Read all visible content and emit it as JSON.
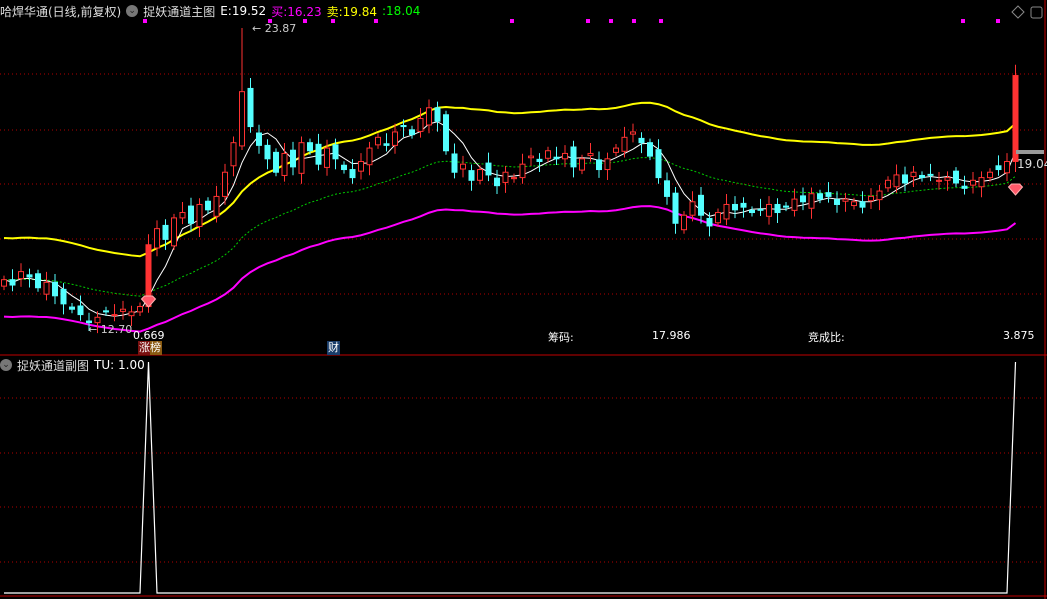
{
  "header": {
    "stock_title": "哈焊华通(日线,前复权)",
    "indicator_name": "捉妖通道主图",
    "e_label": "E:",
    "e_value": "19.52",
    "buy_label": "买:",
    "buy_value": "16.23",
    "sell_label": "卖:",
    "sell_value": "19.84",
    "extra_label": ":",
    "extra_value": "18.04"
  },
  "sub_header": {
    "indicator_name": "捉妖通道副图",
    "tu_label": "TU:",
    "tu_value": "1.00"
  },
  "annotations": {
    "high_marker": "23.87",
    "low_marker": "12.70",
    "ratio_value": "0.669",
    "last_price_tag": "19.04",
    "tag_limit_up": "涨榜",
    "tag_finance": "财",
    "chips_label": "筹码:",
    "chips_value": "17.986",
    "bid_ratio_label": "竞成比:",
    "bid_ratio_value": "3.875"
  },
  "colors": {
    "up": "#ff3232",
    "down": "#54ffff",
    "upper_band": "#ffff00",
    "lower_band": "#ff00ff",
    "mid_line": "#00cc00",
    "ma": "#ffffff",
    "grid": "#b00000"
  },
  "chart_data": {
    "type": "candlestick",
    "price_range": [
      12.7,
      23.87
    ],
    "closes": [
      14.5,
      14.3,
      14.8,
      14.6,
      14.2,
      14.4,
      13.9,
      13.6,
      13.4,
      13.2,
      12.9,
      13.1,
      13.3,
      13.2,
      13.4,
      13.3,
      13.5,
      15.8,
      16.4,
      16.0,
      16.8,
      17.0,
      16.6,
      17.3,
      17.1,
      17.6,
      18.5,
      19.6,
      21.5,
      20.2,
      19.5,
      19.0,
      18.5,
      19.2,
      18.7,
      19.6,
      19.3,
      18.8,
      19.4,
      19.0,
      18.6,
      18.3,
      18.9,
      19.4,
      19.8,
      19.5,
      20.0,
      20.2,
      19.9,
      20.5,
      20.9,
      20.4,
      19.3,
      18.5,
      18.8,
      18.2,
      18.6,
      18.4,
      18.0,
      18.5,
      18.3,
      18.8,
      19.1,
      18.9,
      19.3,
      19.0,
      19.2,
      18.7,
      19.0,
      19.2,
      18.6,
      19.0,
      19.4,
      19.8,
      20.0,
      19.6,
      19.1,
      18.3,
      17.6,
      16.6,
      16.9,
      17.4,
      16.9,
      16.5,
      17.0,
      17.3,
      17.1,
      17.2,
      17.0,
      17.1,
      17.3,
      17.0,
      17.2,
      17.5,
      17.4,
      17.7,
      17.5,
      17.6,
      17.3,
      17.5,
      17.4,
      17.2,
      17.6,
      17.8,
      18.2,
      18.4,
      18.1,
      18.5,
      18.3,
      18.4,
      18.2,
      18.3,
      18.1,
      17.9,
      18.2,
      18.3,
      18.5,
      18.6,
      18.9,
      22.1
    ],
    "spike_high_index": 28,
    "spike_high": 23.87,
    "signal_indices": [
      17,
      119
    ],
    "tu_series_nonzero": {
      "17": 1,
      "119": 1
    },
    "tu_range": [
      0,
      1
    ]
  }
}
